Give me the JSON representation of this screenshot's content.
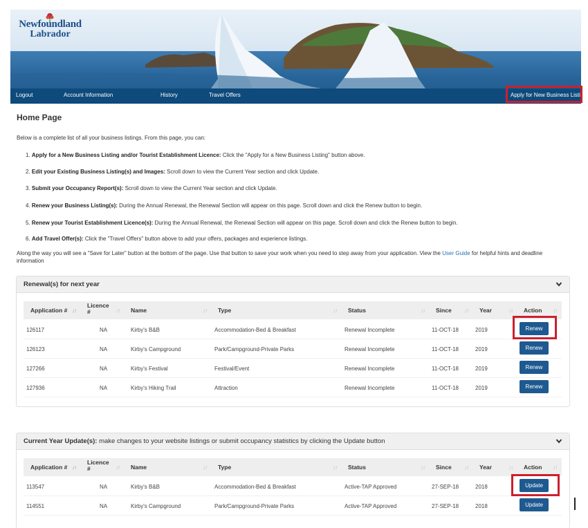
{
  "logo": {
    "line1": "Newfoundland",
    "line2": "Labrador"
  },
  "nav": {
    "logout": "Logout",
    "account": "Account Information",
    "history": "History",
    "travel_offers": "Travel Offers",
    "apply": "Apply for New Business Listing"
  },
  "page_title": "Home Page",
  "intro": "Below is a complete list of all your business listings. From this page, you can:",
  "steps": [
    {
      "num": "1.",
      "bold": "Apply for a New Business Listing and/or Tourist Establishment Licence:",
      "text": " Click the \"Apply for a New Business Listing\" button above."
    },
    {
      "num": "2.",
      "bold": "Edit your Existing Business Listing(s) and Images:",
      "text": " Scroll down to view the Current Year section and click Update."
    },
    {
      "num": "3.",
      "bold": "Submit your Occupancy Report(s):",
      "text": " Scroll down to view the Current Year section and click Update."
    },
    {
      "num": "4.",
      "bold": "Renew your Business Listing(s):",
      "text": " During the Annual Renewal, the Renewal Section will appear on this page. Scroll down and click the Renew button to begin."
    },
    {
      "num": "5.",
      "bold": "Renew your Tourist Establishment Licence(s):",
      "text": " During the Annual Renewal, the Renewal Section will appear on this page. Scroll down and click the Renew button to begin."
    },
    {
      "num": "6.",
      "bold": "Add Travel Offer(s):",
      "text": " Click the \"Travel Offers\" button above to add your offers, packages and experience listings."
    }
  ],
  "along": {
    "before": "Along the way you will see a \"Save for Later\" button at the bottom of the page. Use that button to save your work when you need to step away from your application. View the ",
    "link": "User Guide",
    "after": " for helpful hints and deadline information"
  },
  "columns": {
    "application": "Application #",
    "licence_1": "Licence",
    "licence_2": "#",
    "name": "Name",
    "type": "Type",
    "status": "Status",
    "since": "Since",
    "year": "Year",
    "action": "Action"
  },
  "renewal": {
    "title": "Renewal(s) for next year",
    "rows": [
      {
        "app": "126117",
        "licence": "NA",
        "name": "Kirby's B&B",
        "type": "Accommodation-Bed & Breakfast",
        "status": "Renewal Incomplete",
        "since": "11-OCT-18",
        "year": "2019",
        "action": "Renew"
      },
      {
        "app": "126123",
        "licence": "NA",
        "name": "Kirby's Campground",
        "type": "Park/Campground-Private Parks",
        "status": "Renewal Incomplete",
        "since": "11-OCT-18",
        "year": "2019",
        "action": "Renew"
      },
      {
        "app": "127266",
        "licence": "NA",
        "name": "Kirby's Festival",
        "type": "Festival/Event",
        "status": "Renewal Incomplete",
        "since": "11-OCT-18",
        "year": "2019",
        "action": "Renew"
      },
      {
        "app": "127936",
        "licence": "NA",
        "name": "Kirby's Hiking Trail",
        "type": "Attraction",
        "status": "Renewal Incomplete",
        "since": "11-OCT-18",
        "year": "2019",
        "action": "Renew"
      }
    ]
  },
  "current": {
    "title_bold": "Current Year Update(s):",
    "title_rest": " make changes to your website listings or submit occupancy statistics by clicking the Update button",
    "rows": [
      {
        "app": "113547",
        "licence": "NA",
        "name": "Kirby's B&B",
        "type": "Accommodation-Bed & Breakfast",
        "status": "Active-TAP Approved",
        "since": "27-SEP-18",
        "year": "2018",
        "action": "Update"
      },
      {
        "app": "114551",
        "licence": "NA",
        "name": "Kirby's Campground",
        "type": "Park/Campground-Private Parks",
        "status": "Active-TAP Approved",
        "since": "27-SEP-18",
        "year": "2018",
        "action": "Update"
      }
    ]
  },
  "colors": {
    "nav": "#0e4a7b",
    "button": "#1e5990",
    "highlight": "#cc1f2d",
    "link": "#2a6db5"
  }
}
